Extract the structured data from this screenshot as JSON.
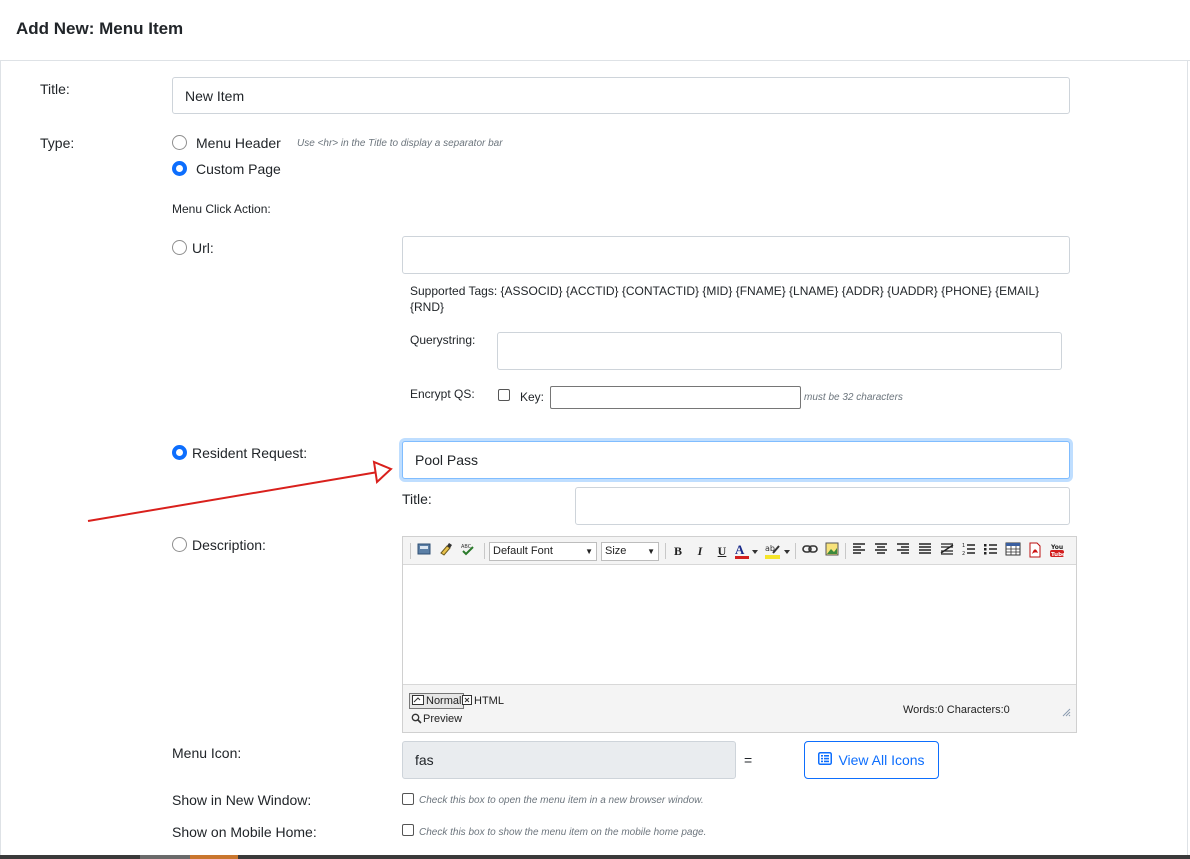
{
  "header": {
    "title": "Add New: Menu Item"
  },
  "form": {
    "title_label": "Title:",
    "title_value": "New Item",
    "type_label": "Type:",
    "type_options": [
      {
        "label": "Menu Header",
        "hint": "Use <hr> in the Title to display a separator bar",
        "selected": false
      },
      {
        "label": "Custom Page",
        "selected": true
      }
    ],
    "click_action_label": "Menu Click Action:",
    "url": {
      "label": "Url:",
      "value": "",
      "supported_tags": "Supported Tags: {ASSOCID} {ACCTID} {CONTACTID} {MID} {FNAME} {LNAME} {ADDR} {UADDR} {PHONE} {EMAIL} {RND}",
      "querystring_label": "Querystring:",
      "querystring_value": "",
      "encrypt_label": "Encrypt QS:",
      "key_label": "Key:",
      "key_value": "",
      "key_hint": "must be 32 characters"
    },
    "resident_request": {
      "label": "Resident Request:",
      "value": "Pool Pass",
      "title_label": "Title:",
      "title_value": ""
    },
    "description": {
      "label": "Description:",
      "font_select": "Default Font",
      "size_select": "Size",
      "mode_normal": "Normal",
      "mode_html": "HTML",
      "mode_preview": "Preview",
      "word_count": "Words:0 Characters:0"
    },
    "menu_icon": {
      "label": "Menu Icon:",
      "value": "fas",
      "equals": "=",
      "view_all_label": "View All Icons"
    },
    "new_window": {
      "label": "Show in New Window:",
      "hint": "Check this box to open the menu item in a new browser window."
    },
    "mobile_home": {
      "label": "Show on Mobile Home:",
      "hint": "Check this box to show the menu item on the mobile home page."
    }
  },
  "colors": {
    "accent": "#0d6efd",
    "annotation_arrow": "#d9201c",
    "border": "#ced4da"
  }
}
